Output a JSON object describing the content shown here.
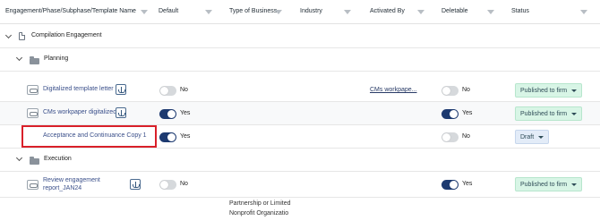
{
  "header": {
    "columns": [
      {
        "key": "name",
        "label": "Engagement/Phase/Subphase/Template Name"
      },
      {
        "key": "default",
        "label": "Default"
      },
      {
        "key": "business",
        "label": "Type of Business"
      },
      {
        "key": "industry",
        "label": "Industry"
      },
      {
        "key": "activated",
        "label": "Activated By"
      },
      {
        "key": "deletable",
        "label": "Deletable"
      },
      {
        "key": "status",
        "label": "Status"
      }
    ]
  },
  "engagement": {
    "label": "Compilation Engagement"
  },
  "groups": [
    {
      "label": "Planning"
    },
    {
      "label": "Execution"
    }
  ],
  "templates": [
    {
      "name": "Digitalized template letter",
      "default": "No",
      "activated_by": "CMs workpape...",
      "deletable": "No",
      "status": "Published to firm"
    },
    {
      "name": "CMs workpaper digitalized",
      "default": "Yes",
      "activated_by": "",
      "deletable": "Yes",
      "status": "Published to firm"
    },
    {
      "name": "Acceptance and Continuance Copy 1",
      "default": "Yes",
      "activated_by": "",
      "deletable": "No",
      "status": "Draft"
    },
    {
      "name_line1": "Review engagement",
      "name_line2": "report_JAN24",
      "default": "No",
      "activated_by": "",
      "deletable": "Yes",
      "status": "Published to firm"
    }
  ],
  "business_types": [
    "Partnership or Limited",
    "Nonprofit Organizatio"
  ],
  "colors": {
    "toggle_on": "#1d3a70",
    "published": "#d8f5e6",
    "draft": "#e3ecf8",
    "highlight": "#d9202a"
  }
}
